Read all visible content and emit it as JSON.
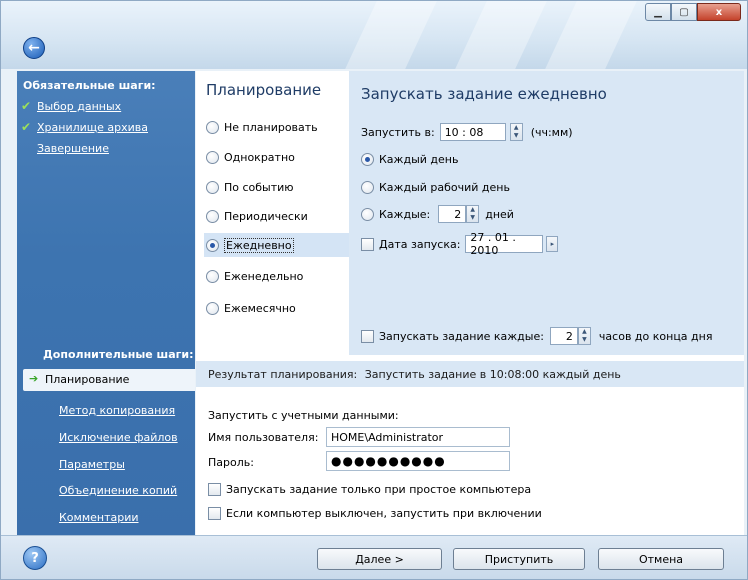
{
  "window": {
    "min_icon": "minimize-icon",
    "max_icon": "maximize-icon",
    "close_icon": "close-icon",
    "close_glyph": "x"
  },
  "sidebar": {
    "required_heading": "Обязательные шаги:",
    "required_items": [
      {
        "label": "Выбор данных",
        "done": true
      },
      {
        "label": "Хранилище архива",
        "done": true
      },
      {
        "label": "Завершение",
        "done": false
      }
    ],
    "optional_heading": "Дополнительные шаги:",
    "active_item": "Планирование",
    "optional_items": [
      "Метод копирования",
      "Исключение файлов",
      "Параметры",
      "Объединение копий",
      "Комментарии"
    ]
  },
  "planning": {
    "title": "Планирование",
    "options": [
      "Не планировать",
      "Однократно",
      "По событию",
      "Периодически",
      "Ежедневно",
      "Еженедельно",
      "Ежемесячно"
    ],
    "selected_index": 4
  },
  "daily": {
    "title": "Запускать задание ежедневно",
    "start_label": "Запустить в:",
    "start_time": "10 : 08",
    "time_unit": "(чч:мм)",
    "every_day": "Каждый день",
    "every_workday": "Каждый рабочий день",
    "every_n_label": "Каждые:",
    "every_n_value": "2",
    "days_label": "дней",
    "start_date_label": "Дата запуска:",
    "start_date_value": "27 . 01 . 2010",
    "repeat_label": "Запускать задание каждые:",
    "repeat_value": "2",
    "repeat_suffix": "часов до конца дня"
  },
  "result": {
    "label": "Результат планирования:",
    "text": "Запустить задание в 10:08:00 каждый день"
  },
  "credentials": {
    "heading": "Запустить с учетными данными:",
    "user_label": "Имя пользователя:",
    "user_value": "HOME\\Administrator",
    "password_label": "Пароль:",
    "password_value": "●●●●●●●●●●"
  },
  "conditions": {
    "idle_only": "Запускать задание только при простое компьютера",
    "run_on_startup": "Если компьютер выключен, запустить при включении"
  },
  "buttons": {
    "next": "Далее >",
    "proceed": "Приступить",
    "cancel": "Отмена"
  }
}
